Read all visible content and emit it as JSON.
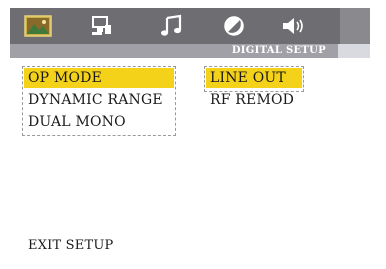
{
  "tabs": [
    {
      "icon": "landscape-picture-icon",
      "active": true
    },
    {
      "icon": "speaker-setup-icon",
      "active": false
    },
    {
      "icon": "music-note-icon",
      "active": false
    },
    {
      "icon": "contrast-circle-icon",
      "active": false
    },
    {
      "icon": "volume-speaker-icon",
      "active": false
    }
  ],
  "header": {
    "title": "DIGITAL SETUP"
  },
  "main_menu": {
    "items": [
      "OP MODE",
      "DYNAMIC RANGE",
      "DUAL MONO"
    ],
    "selected_index": 0
  },
  "sub_menu": {
    "items": [
      "LINE OUT",
      "RF REMOD"
    ],
    "selected_index": 0
  },
  "footer": {
    "exit_label": "EXIT SETUP"
  },
  "colors": {
    "highlight": "#f5d21a",
    "topbar": "#6e6e72",
    "subheader": "#a0a0a6"
  }
}
